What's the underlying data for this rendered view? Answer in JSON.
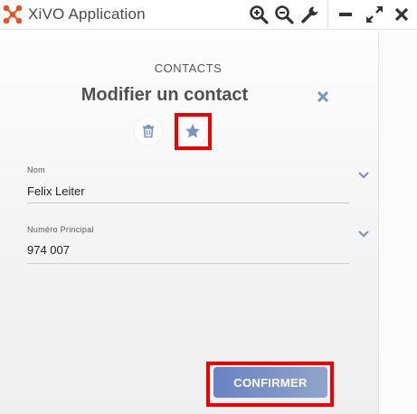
{
  "app": {
    "title": "XiVO Application"
  },
  "toolbar": {
    "zoom_in_icon": "magnifier-plus",
    "zoom_out_icon": "magnifier-minus",
    "settings_icon": "wrench",
    "minimize_icon": "minus",
    "maximize_icon": "arrows-expand",
    "close_icon": "x"
  },
  "header": {
    "section": "CONTACTS",
    "title": "Modifier un contact",
    "close_icon": "x"
  },
  "actions": {
    "delete_icon": "trash",
    "favorite_icon": "star"
  },
  "fields": [
    {
      "label": "Nom",
      "value": "Felix Leiter"
    },
    {
      "label": "Numéro Principal",
      "value": "974 007"
    }
  ],
  "footer": {
    "confirm_label": "CONFIRMER"
  },
  "colors": {
    "accent": "#7b92c9",
    "highlight": "#ee0000",
    "logo": "#e8542a"
  }
}
